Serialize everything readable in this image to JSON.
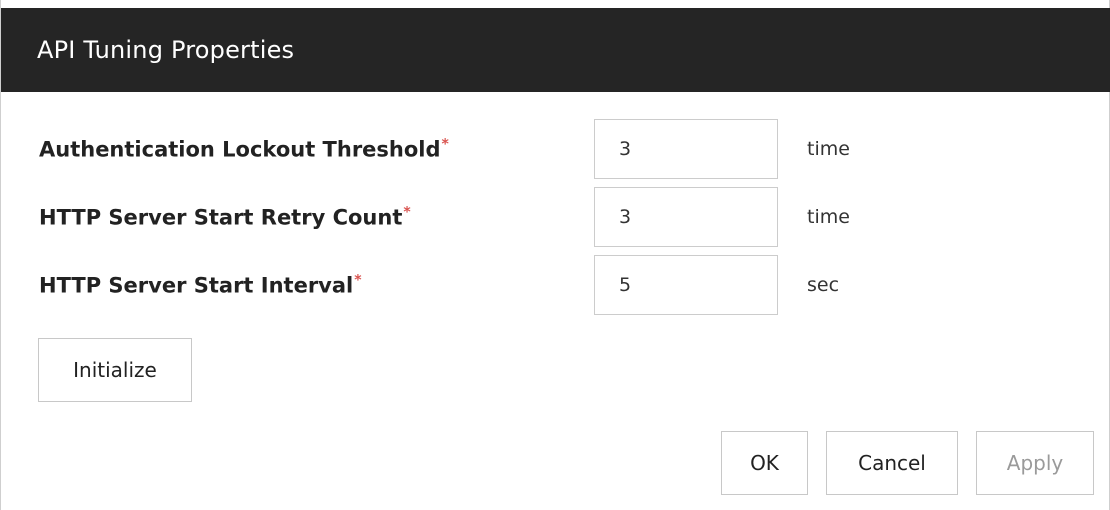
{
  "dialog": {
    "title": "API Tuning Properties"
  },
  "fields": [
    {
      "label": "Authentication Lockout Threshold",
      "required_mark": "*",
      "value": "3",
      "unit": "time"
    },
    {
      "label": "HTTP Server Start Retry Count",
      "required_mark": "*",
      "value": "3",
      "unit": "time"
    },
    {
      "label": "HTTP Server Start Interval",
      "required_mark": "*",
      "value": "5",
      "unit": "sec"
    }
  ],
  "buttons": {
    "initialize": "Initialize",
    "ok": "OK",
    "cancel": "Cancel",
    "apply": "Apply"
  },
  "colors": {
    "titlebar_bg": "#252525",
    "required": "#d9534f",
    "disabled_text": "#9a9a9a"
  }
}
